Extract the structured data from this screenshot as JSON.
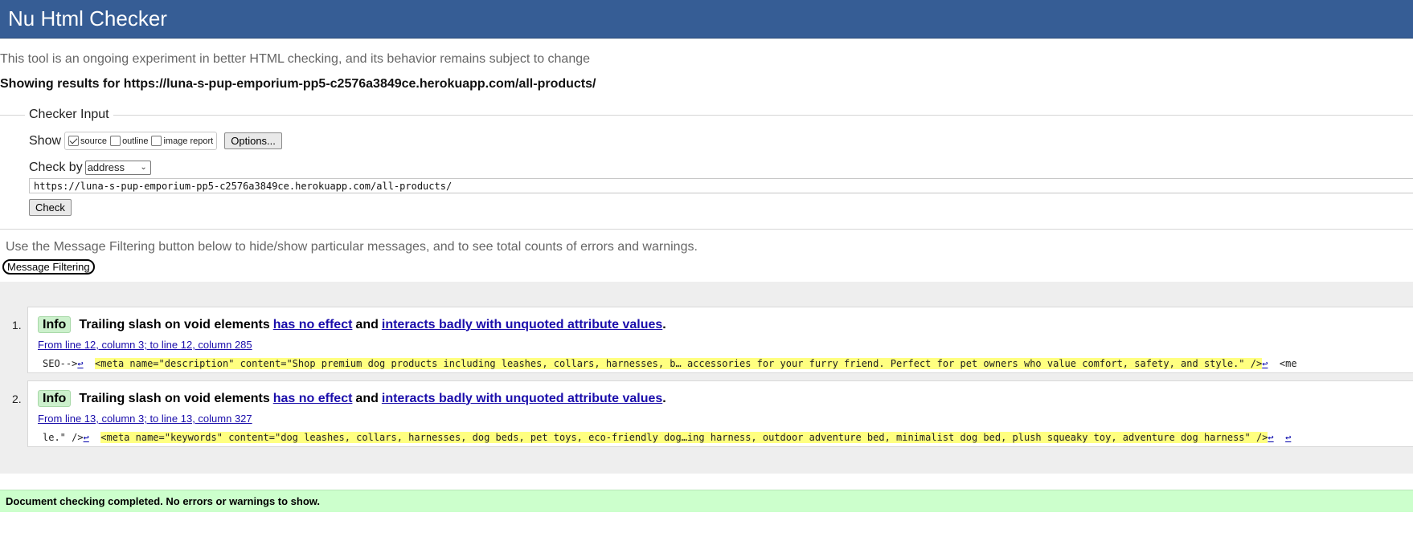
{
  "app": {
    "title": "Nu Html Checker"
  },
  "intro": "This tool is an ongoing experiment in better HTML checking, and its behavior remains subject to change",
  "showing_results": "Showing results for https://luna-s-pup-emporium-pp5-c2576a3849ce.herokuapp.com/all-products/",
  "checker": {
    "legend": "Checker Input",
    "show_label": "Show",
    "show_options": [
      {
        "label": "source",
        "checked": true
      },
      {
        "label": "outline",
        "checked": false
      },
      {
        "label": "image report",
        "checked": false
      }
    ],
    "options_button": "Options...",
    "check_by_label": "Check by",
    "check_by_value": "address",
    "url_value": "https://luna-s-pup-emporium-pp5-c2576a3849ce.herokuapp.com/all-products/",
    "check_button": "Check"
  },
  "filter_note": "Use the Message Filtering button below to hide/show particular messages, and to see total counts of errors and warnings.",
  "message_filtering_button": "Message Filtering",
  "messages": [
    {
      "number": "1.",
      "type": "Info",
      "text_before": "Trailing slash on void elements",
      "link1": "has no effect",
      "text_mid": "and",
      "link2": "interacts badly with unquoted attribute values",
      "text_end": ".",
      "location": "From line 12, column 3; to line 12, column 285",
      "code_pre": "SEO-->",
      "code_highlight": "<meta name=\"description\" content=\"Shop premium dog products including leashes, collars, harnesses, b… accessories for your furry friend. Perfect for pet owners who value comfort, safety, and style.\" />",
      "code_post": "<me"
    },
    {
      "number": "2.",
      "type": "Info",
      "text_before": "Trailing slash on void elements",
      "link1": "has no effect",
      "text_mid": "and",
      "link2": "interacts badly with unquoted attribute values",
      "text_end": ".",
      "location": "From line 13, column 3; to line 13, column 327",
      "code_pre": "le.\" />",
      "code_highlight": "<meta name=\"keywords\" content=\"dog leashes, collars, harnesses, dog beds, pet toys, eco-friendly dog…ing harness, outdoor adventure bed, minimalist dog bed, plush squeaky toy, adventure dog harness\" />",
      "code_post": ""
    }
  ],
  "icons": {
    "return_glyph": "↩",
    "checkmark": "check-icon",
    "dropdown": "chevron-down-icon"
  },
  "status": "Document checking completed. No errors or warnings to show.",
  "colors": {
    "header_bg": "#365d95",
    "info_badge_bg": "#ccf0cc",
    "highlight": "#ffff80",
    "status_bg": "#ccffcc",
    "link": "#1a0dab"
  }
}
